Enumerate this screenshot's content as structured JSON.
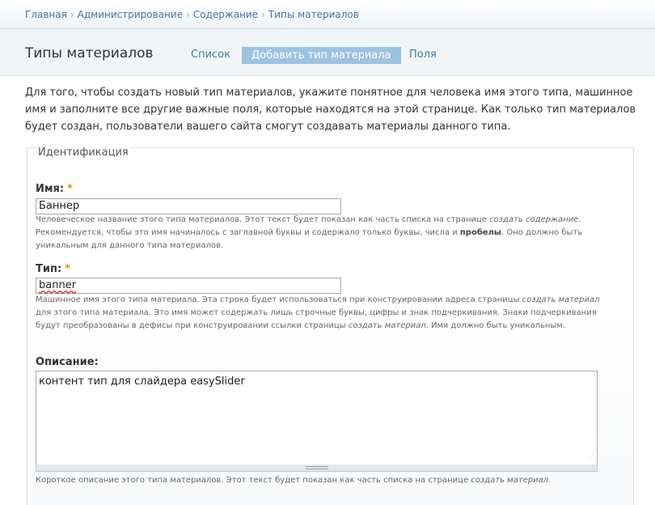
{
  "breadcrumb": {
    "items": [
      "Главная",
      "Администрирование",
      "Содержание",
      "Типы материалов"
    ],
    "separator": "›"
  },
  "header": {
    "title": "Типы материалов",
    "tabs": [
      "Список",
      "Добавить тип материала",
      "Поля"
    ],
    "active_tab": "Добавить тип материала"
  },
  "intro": "Для того, чтобы создать новый тип материалов, укажите понятное для человека имя этого типа, машинное имя и заполните все другие важные поля, которые находятся на этой странице. Как только тип материалов будет создан, пользователи вашего сайта смогут создавать материалы данного типа.",
  "fieldset": {
    "legend": "Идентификация"
  },
  "name_field": {
    "label": "Имя:",
    "required_mark": "*",
    "value": "Баннер",
    "desc_1": "Человеческое название этого типа материалов. Этот текст будет показан как часть списка на странице ",
    "desc_link": "создать содержание",
    "desc_2": ". Рекомендуется, чтобы это имя начиналось с заглавной буквы и содержало только буквы, числа и ",
    "desc_bold": "пробелы",
    "desc_3": ". Оно должно быть уникальным для данного типа материалов."
  },
  "type_field": {
    "label": "Тип:",
    "required_mark": "*",
    "value": "banner",
    "desc_1": "Машинное имя этого типа материала. Эта строка будет использоваться при конструировании адреса страницы ",
    "desc_link_1": "создать материал",
    "desc_2": " для этого типа материала. Это имя может содержать лишь строчные буквы, цифры и знак подчеркивания. Знаки подчеркивания будут преобразованы в дефисы при конструировании ссылки страницы ",
    "desc_link_2": "создать материал",
    "desc_3": ". Имя должно быть уникальным."
  },
  "description_field": {
    "label": "Описание:",
    "value": "контент тип для слайдера easySlider",
    "desc_1": "Короткое описание этого типа материалов. Этот текст будет показан как часть списка на странице ",
    "desc_link": "создать материал",
    "desc_2": "."
  },
  "colors": {
    "link": "#3f77a7",
    "active_tab_bg": "#9cc3e0",
    "required": "#e09010"
  }
}
